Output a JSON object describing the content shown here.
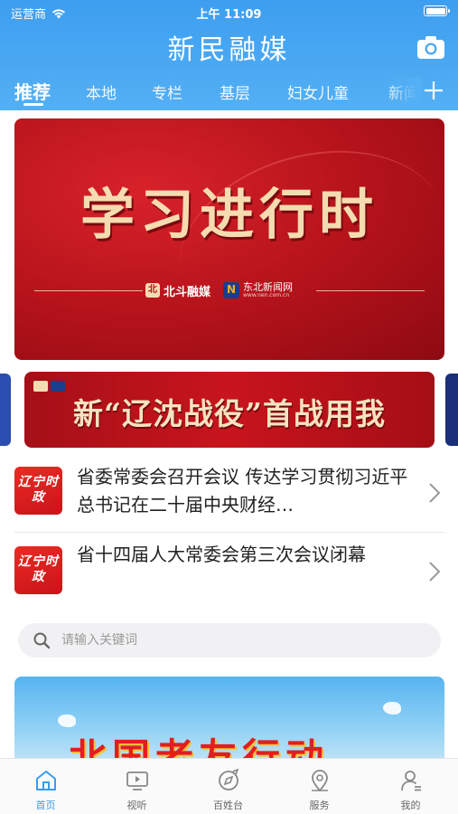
{
  "status_bar": {
    "carrier": "运营商",
    "time": "上午 11:09",
    "battery_level": 1.0
  },
  "header": {
    "app_title": "新民融媒",
    "camera_icon": "camera-icon",
    "add_icon": "plus-icon"
  },
  "tabs": [
    {
      "label": "推荐",
      "active": true
    },
    {
      "label": "本地",
      "active": false
    },
    {
      "label": "专栏",
      "active": false
    },
    {
      "label": "基层",
      "active": false
    },
    {
      "label": "妇女儿童",
      "active": false
    },
    {
      "label": "新闻",
      "active": false
    }
  ],
  "main_banner": {
    "title": "学习进行时",
    "logo_a": "北斗融媒",
    "logo_b": "东北新闻网",
    "logo_b_url": "www.nen.com.cn"
  },
  "sub_banner": {
    "title": "新“辽沈战役”首战用我"
  },
  "news": [
    {
      "badge": "辽宁时政",
      "title": "省委常委会召开会议 传达学习贯彻习近平总书记在二十届中央财经…"
    },
    {
      "badge": "辽宁时政",
      "title": "省十四届人大常委会第三次会议闭幕"
    }
  ],
  "search": {
    "placeholder": "请输入关键词"
  },
  "bottom_banner": {
    "text": "北国老友行动"
  },
  "bottom_nav": [
    {
      "label": "首页",
      "icon": "home-icon",
      "active": true
    },
    {
      "label": "视听",
      "icon": "tv-icon",
      "active": false
    },
    {
      "label": "百姓台",
      "icon": "compass-icon",
      "active": false
    },
    {
      "label": "服务",
      "icon": "location-pin-icon",
      "active": false
    },
    {
      "label": "我的",
      "icon": "user-icon",
      "active": false
    }
  ],
  "colors": {
    "header_blue": "#3d9ef0",
    "banner_red": "#c8141d",
    "active_blue": "#3a9bed"
  }
}
